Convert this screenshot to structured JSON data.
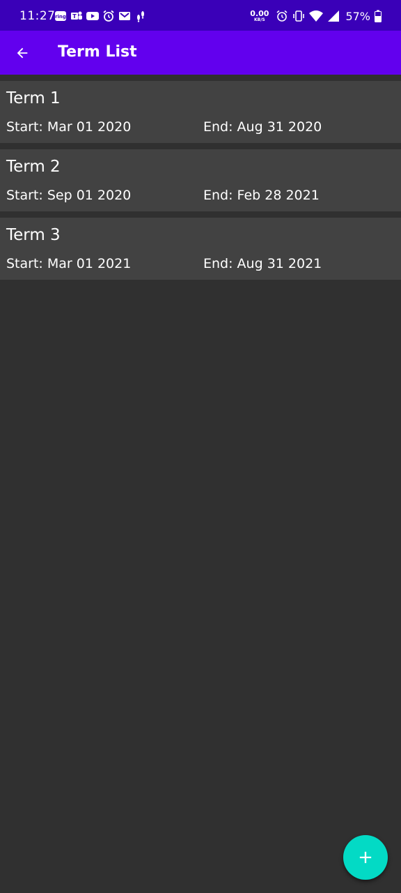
{
  "status_bar": {
    "time": "11:27",
    "net_speed_value": "0.00",
    "net_speed_unit": "KB/S",
    "battery_percent": "57%",
    "left_icons": [
      "ring-icon",
      "teams-icon",
      "youtube-icon",
      "alarm-icon",
      "gmail-icon",
      "fit-icon"
    ],
    "right_icons": [
      "alarm-icon",
      "vibrate-icon",
      "wifi-icon",
      "signal-icon",
      "battery-icon"
    ]
  },
  "app_bar": {
    "title": "Term List",
    "back_icon": "arrow-back-icon"
  },
  "terms": [
    {
      "title": "Term 1",
      "start": "Start: Mar 01 2020",
      "end": "End: Aug 31 2020"
    },
    {
      "title": "Term 2",
      "start": "Start: Sep 01 2020",
      "end": "End: Feb 28 2021"
    },
    {
      "title": "Term 3",
      "start": "Start: Mar 01 2021",
      "end": "End: Aug 31 2021"
    }
  ],
  "fab": {
    "icon": "plus-icon"
  },
  "colors": {
    "status_bar": "#3a00b8",
    "app_bar": "#6200ee",
    "background": "#303030",
    "card": "#424242",
    "fab": "#03dac5"
  }
}
